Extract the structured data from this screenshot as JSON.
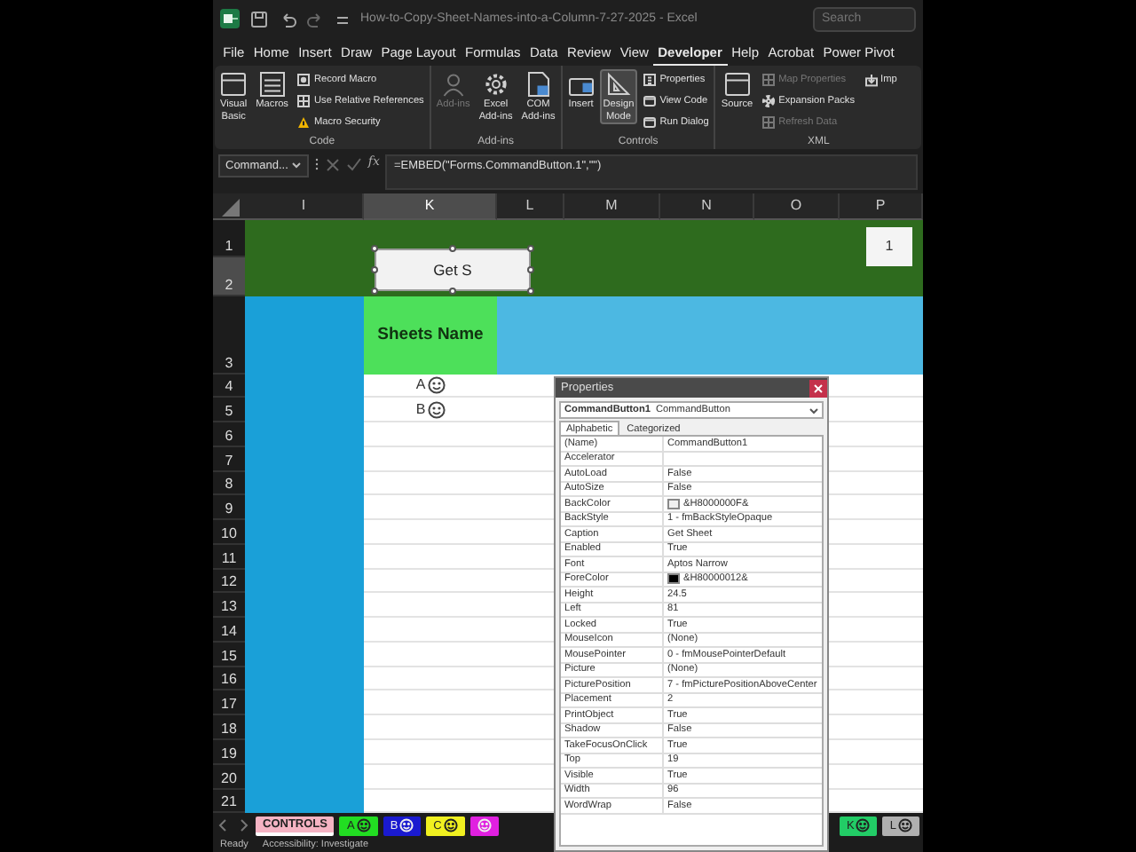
{
  "title_bar": {
    "title": "How-to-Copy-Sheet-Names-into-a-Column-7-27-2025  -  Excel",
    "search_placeholder": "Search"
  },
  "menu_tabs": [
    {
      "label": "File",
      "selected": false
    },
    {
      "label": "Home",
      "selected": false
    },
    {
      "label": "Insert",
      "selected": false
    },
    {
      "label": "Draw",
      "selected": false
    },
    {
      "label": "Page Layout",
      "selected": false
    },
    {
      "label": "Formulas",
      "selected": false
    },
    {
      "label": "Data",
      "selected": false
    },
    {
      "label": "Review",
      "selected": false
    },
    {
      "label": "View",
      "selected": false
    },
    {
      "label": "Developer",
      "selected": true
    },
    {
      "label": "Help",
      "selected": false
    },
    {
      "label": "Acrobat",
      "selected": false
    },
    {
      "label": "Power Pivot",
      "selected": false
    }
  ],
  "ribbon": {
    "groups": [
      {
        "label": "Code",
        "buttons": [
          {
            "label": "Visual Basic",
            "kind": "large",
            "disabled": false,
            "on": false
          },
          {
            "label": "Macros",
            "kind": "large",
            "disabled": false,
            "on": false
          },
          {
            "label": "Record Macro",
            "kind": "small",
            "disabled": false,
            "on": false
          },
          {
            "label": "Use Relative References",
            "kind": "small",
            "disabled": false,
            "on": false
          },
          {
            "label": "Macro Security",
            "kind": "small",
            "disabled": false,
            "on": false
          }
        ]
      },
      {
        "label": "Add-ins",
        "buttons": [
          {
            "label": "Add-ins",
            "kind": "large",
            "disabled": true,
            "on": false
          },
          {
            "label": "Excel Add-ins",
            "kind": "large",
            "disabled": false,
            "on": false
          },
          {
            "label": "COM Add-ins",
            "kind": "large",
            "disabled": false,
            "on": false
          }
        ]
      },
      {
        "label": "Controls",
        "buttons": [
          {
            "label": "Insert",
            "kind": "large",
            "disabled": false,
            "on": false
          },
          {
            "label": "Design Mode",
            "kind": "large",
            "disabled": false,
            "on": true
          },
          {
            "label": "Properties",
            "kind": "small",
            "disabled": false,
            "on": false
          },
          {
            "label": "View Code",
            "kind": "small",
            "disabled": false,
            "on": false
          },
          {
            "label": "Run Dialog",
            "kind": "small",
            "disabled": false,
            "on": false
          }
        ]
      },
      {
        "label": "XML",
        "buttons": [
          {
            "label": "Source",
            "kind": "large",
            "disabled": false,
            "on": false
          },
          {
            "label": "Map Properties",
            "kind": "small",
            "disabled": true,
            "on": false
          },
          {
            "label": "Expansion Packs",
            "kind": "small",
            "disabled": false,
            "on": false
          },
          {
            "label": "Refresh Data",
            "kind": "small",
            "disabled": true,
            "on": false
          },
          {
            "label": "Imp",
            "kind": "small",
            "disabled": false,
            "on": false
          }
        ]
      }
    ]
  },
  "formula_bar": {
    "name_box": "Command...",
    "fx_label": "fx",
    "formula": "=EMBED(\"Forms.CommandButton.1\",\"\")"
  },
  "sheet": {
    "columns": [
      {
        "label": "I",
        "selected": false
      },
      {
        "label": "K",
        "selected": true
      },
      {
        "label": "L",
        "selected": false
      },
      {
        "label": "M",
        "selected": false
      },
      {
        "label": "N",
        "selected": false
      },
      {
        "label": "O",
        "selected": false
      },
      {
        "label": "P",
        "selected": false
      }
    ],
    "rows": [
      {
        "label": "1",
        "selected": false
      },
      {
        "label": "2",
        "selected": true
      },
      {
        "label": "3",
        "selected": false
      },
      {
        "label": "4",
        "selected": false
      },
      {
        "label": "5",
        "selected": false
      },
      {
        "label": "6",
        "selected": false
      },
      {
        "label": "7",
        "selected": false
      },
      {
        "label": "8",
        "selected": false
      },
      {
        "label": "9",
        "selected": false
      },
      {
        "label": "10",
        "selected": false
      },
      {
        "label": "11",
        "selected": false
      },
      {
        "label": "12",
        "selected": false
      },
      {
        "label": "13",
        "selected": false
      },
      {
        "label": "14",
        "selected": false
      },
      {
        "label": "15",
        "selected": false
      },
      {
        "label": "16",
        "selected": false
      },
      {
        "label": "17",
        "selected": false
      },
      {
        "label": "18",
        "selected": false
      },
      {
        "label": "19",
        "selected": false
      },
      {
        "label": "20",
        "selected": false
      },
      {
        "label": "21",
        "selected": false
      }
    ],
    "header_cell": "Sheets Name",
    "names": [
      "A",
      "B"
    ],
    "button_caption": "Get S",
    "box_value": "1"
  },
  "properties": {
    "title": "Properties",
    "object": "CommandButton1",
    "object_type": "CommandButton",
    "tabs": [
      {
        "label": "Alphabetic",
        "selected": true
      },
      {
        "label": "Categorized",
        "selected": false
      }
    ],
    "rows": [
      {
        "name": "(Name)",
        "value": "CommandButton1"
      },
      {
        "name": "Accelerator"
      },
      {
        "name": "AutoLoad",
        "value": "False"
      },
      {
        "name": "AutoSize",
        "value": "False"
      },
      {
        "name": "BackColor",
        "value": "&H8000000F&",
        "color": "#f0f0f0"
      },
      {
        "name": "BackStyle",
        "value": "1 - fmBackStyleOpaque"
      },
      {
        "name": "Caption",
        "value": "Get Sheet"
      },
      {
        "name": "Enabled",
        "value": "True"
      },
      {
        "name": "Font",
        "value": "Aptos Narrow"
      },
      {
        "name": "ForeColor",
        "value": "&H80000012&",
        "color": "#000000"
      },
      {
        "name": "Height",
        "value": "24.5"
      },
      {
        "name": "Left",
        "value": "81"
      },
      {
        "name": "Locked",
        "value": "True"
      },
      {
        "name": "MouseIcon",
        "value": "(None)"
      },
      {
        "name": "MousePointer",
        "value": "0 - fmMousePointerDefault"
      },
      {
        "name": "Picture",
        "value": "(None)"
      },
      {
        "name": "PicturePosition",
        "value": "7 - fmPicturePositionAboveCenter"
      },
      {
        "name": "Placement",
        "value": "2"
      },
      {
        "name": "PrintObject",
        "value": "True"
      },
      {
        "name": "Shadow",
        "value": "False"
      },
      {
        "name": "TakeFocusOnClick",
        "value": "True"
      },
      {
        "name": "Top",
        "value": "19"
      },
      {
        "name": "Visible",
        "value": "True"
      },
      {
        "name": "Width",
        "value": "96"
      },
      {
        "name": "WordWrap",
        "value": "False"
      }
    ]
  },
  "sheet_tabs": {
    "left": [
      {
        "label": "CONTROLS",
        "color": "#f5b3c3",
        "smiley": false,
        "selected": true
      },
      {
        "label": "A",
        "color": "#22dd22",
        "smiley": true,
        "selected": false
      },
      {
        "label": "B",
        "color": "#1a1ad0",
        "smiley": true,
        "selected": false
      },
      {
        "label": "C",
        "color": "#f0f020",
        "smiley": true,
        "selected": false
      },
      {
        "color": "#e020e0",
        "smiley": true,
        "selected": false
      }
    ],
    "right": [
      {
        "label": "K",
        "color": "#22cc66",
        "smiley": true,
        "selected": false
      },
      {
        "label": "L",
        "color": "#b0b0b0",
        "smiley": true,
        "selected": false
      }
    ]
  },
  "status_bar": {
    "items": [
      "Ready",
      "Accessibility: Investigate"
    ]
  }
}
